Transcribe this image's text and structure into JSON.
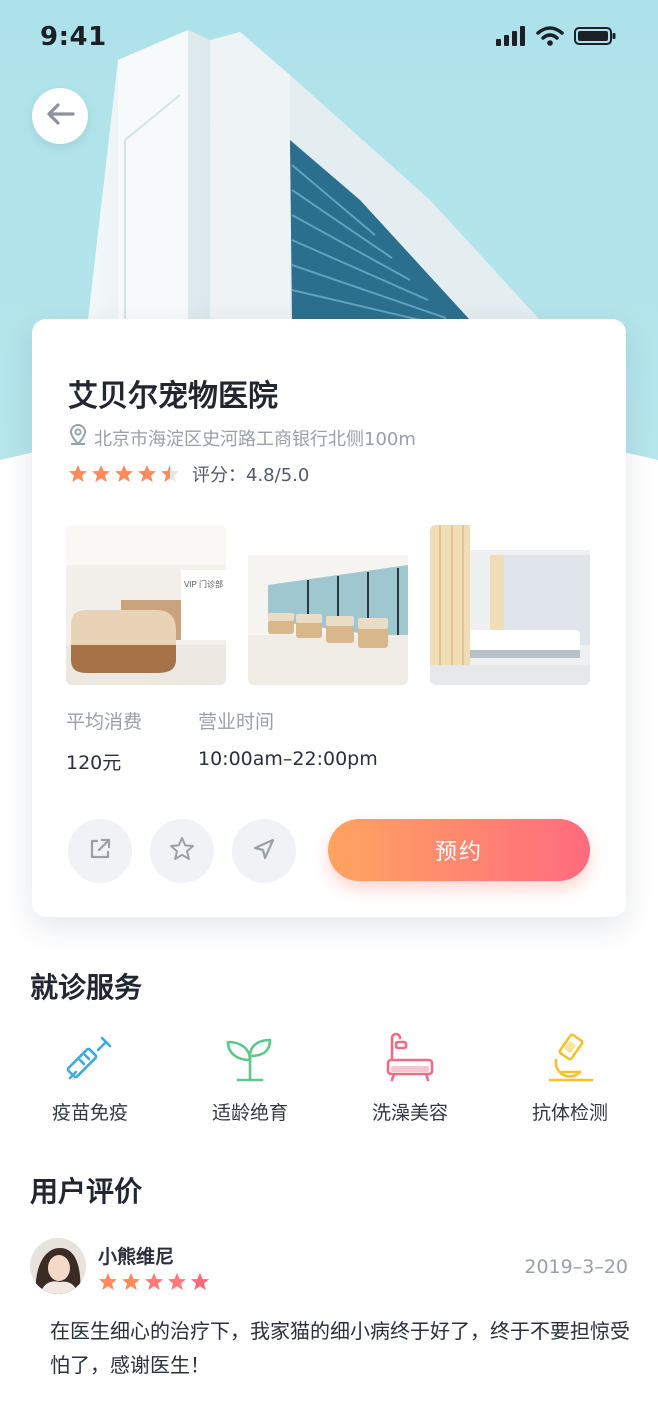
{
  "status_bar": {
    "time": "9:41"
  },
  "hospital": {
    "name": "艾贝尔宠物医院",
    "address": "北京市海淀区史河路工商银行北侧100m",
    "rating_text": "评分：4.8/5.0",
    "rating_value": 4.8,
    "rating_max": 5.0
  },
  "info": {
    "avg_cost_label": "平均消费",
    "avg_cost_value": "120元",
    "hours_label": "营业时间",
    "hours_value": "10:00am–22:00pm"
  },
  "actions": {
    "book_label": "预约",
    "icons": [
      "share-icon",
      "star-icon",
      "navigate-icon"
    ]
  },
  "services": {
    "title": "就诊服务",
    "items": [
      {
        "label": "疫苗免疫",
        "icon": "syringe-icon",
        "color": "#3fa9e0"
      },
      {
        "label": "适龄绝育",
        "icon": "sprout-icon",
        "color": "#5cc98a"
      },
      {
        "label": "洗澡美容",
        "icon": "bathtub-icon",
        "color": "#f06b86"
      },
      {
        "label": "抗体检测",
        "icon": "microscope-icon",
        "color": "#f2c230"
      }
    ]
  },
  "reviews": {
    "title": "用户评价",
    "items": [
      {
        "user": "小熊维尼",
        "date": "2019–3–20",
        "stars": 5,
        "text": "在医生细心的治疗下，我家猫的细小病终于好了，终于不要担惊受怕了，感谢医生！"
      }
    ]
  },
  "colors": {
    "sky": "#a9e1e8",
    "accent_start": "#ffa460",
    "accent_end": "#ff6b7d",
    "star": "#ff8a5c"
  }
}
